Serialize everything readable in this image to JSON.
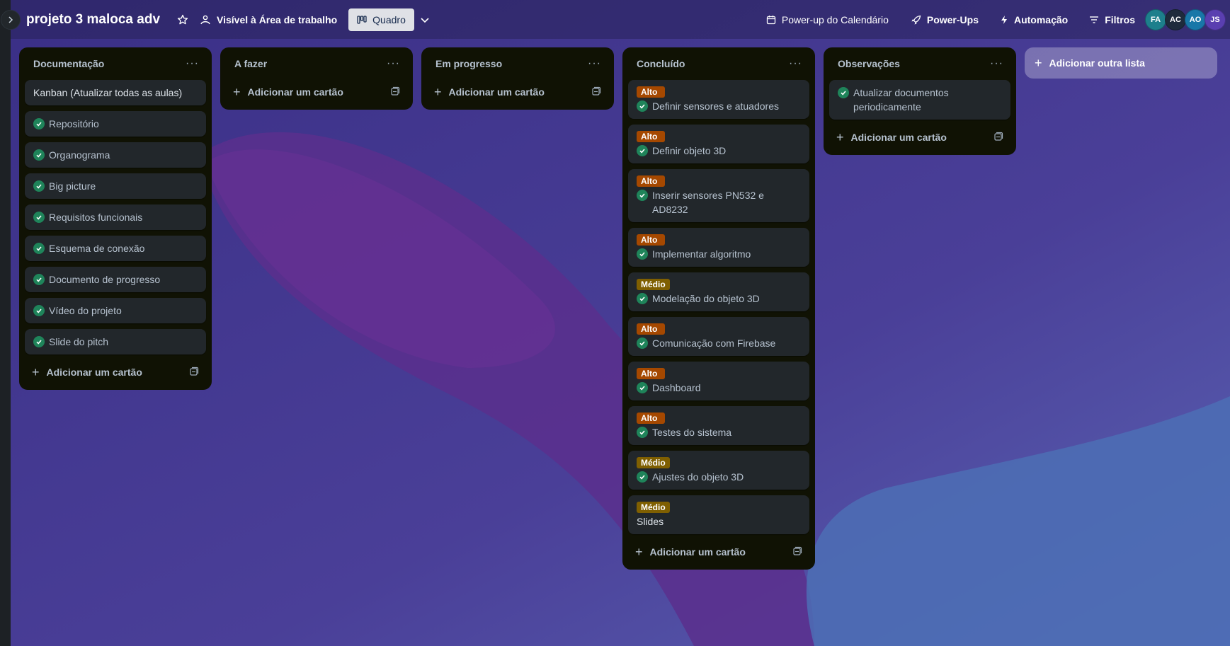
{
  "board": {
    "title": "projeto 3 maloca adv",
    "visibility": "Visível à Área de trabalho",
    "view": "Quadro"
  },
  "header": {
    "calendar": "Power-up do Calendário",
    "powerups": "Power-Ups",
    "automation": "Automação",
    "filters": "Filtros"
  },
  "members": [
    {
      "initials": "FA",
      "color": "#1d7f8c"
    },
    {
      "initials": "AC",
      "color": "#1e2b3c"
    },
    {
      "initials": "AO",
      "color": "#1877a8"
    },
    {
      "initials": "JS",
      "color": "#5a3fb0"
    }
  ],
  "labels": {
    "alto": {
      "text": "Alto",
      "color": "#a54800"
    },
    "medio": {
      "text": "Médio",
      "color": "#7f5f01"
    }
  },
  "add_card_label": "Adicionar um cartão",
  "add_list_label": "Adicionar outra lista",
  "lists": [
    {
      "title": "Documentação",
      "cards": [
        {
          "text": "Kanban (Atualizar todas as aulas)",
          "done": false,
          "label": null
        },
        {
          "text": "Repositório",
          "done": true,
          "label": null
        },
        {
          "text": "Organograma",
          "done": true,
          "label": null
        },
        {
          "text": "Big picture",
          "done": true,
          "label": null
        },
        {
          "text": "Requisitos funcionais",
          "done": true,
          "label": null
        },
        {
          "text": "Esquema de conexão",
          "done": true,
          "label": null
        },
        {
          "text": "Documento de progresso",
          "done": true,
          "label": null
        },
        {
          "text": "Vídeo do projeto",
          "done": true,
          "label": null
        },
        {
          "text": "Slide do pitch",
          "done": true,
          "label": null
        }
      ]
    },
    {
      "title": "A fazer",
      "cards": []
    },
    {
      "title": "Em progresso",
      "cards": []
    },
    {
      "title": "Concluído",
      "cards": [
        {
          "text": "Definir sensores e atuadores",
          "done": true,
          "label": "alto"
        },
        {
          "text": "Definir objeto 3D",
          "done": true,
          "label": "alto"
        },
        {
          "text": "Inserir sensores PN532 e AD8232",
          "done": true,
          "label": "alto"
        },
        {
          "text": "Implementar algoritmo",
          "done": true,
          "label": "alto"
        },
        {
          "text": "Modelação do objeto 3D",
          "done": true,
          "label": "medio"
        },
        {
          "text": "Comunicação com Firebase",
          "done": true,
          "label": "alto"
        },
        {
          "text": "Dashboard",
          "done": true,
          "label": "alto"
        },
        {
          "text": "Testes do sistema",
          "done": true,
          "label": "alto"
        },
        {
          "text": "Ajustes do objeto 3D",
          "done": true,
          "label": "medio"
        },
        {
          "text": "Slides",
          "done": false,
          "label": "medio"
        }
      ]
    },
    {
      "title": "Observações",
      "cards": [
        {
          "text": "Atualizar documentos periodicamente",
          "done": true,
          "label": null
        }
      ]
    }
  ]
}
